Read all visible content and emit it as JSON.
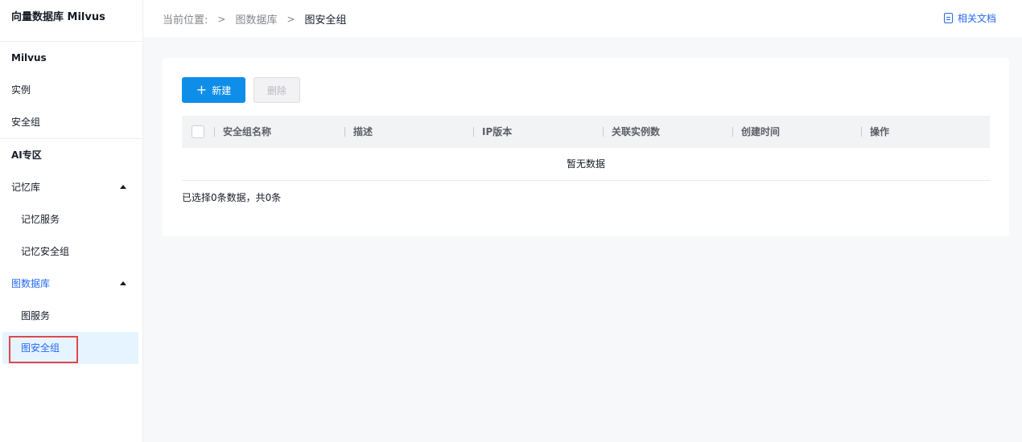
{
  "sidebar": {
    "title": "向量数据库 Milvus",
    "groups": [
      {
        "head": "Milvus",
        "items": [
          "实例",
          "安全组"
        ]
      },
      {
        "head": "AI专区"
      }
    ],
    "memory": {
      "label": "记忆库",
      "children": [
        "记忆服务",
        "记忆安全组"
      ]
    },
    "graph": {
      "label": "图数据库",
      "children": [
        "图服务",
        "图安全组"
      ]
    }
  },
  "breadcrumb": {
    "prefix": "当前位置:",
    "items": [
      "图数据库",
      "图安全组"
    ],
    "separator": ">"
  },
  "doc_link": "相关文档",
  "toolbar": {
    "new_label": "新建",
    "new_icon": "+",
    "delete_label": "删除"
  },
  "table": {
    "columns": [
      "安全组名称",
      "描述",
      "IP版本",
      "关联实例数",
      "创建时间",
      "操作"
    ],
    "empty_text": "暂无数据"
  },
  "summary": "已选择0条数据，共0条",
  "colors": {
    "primary": "#0f8ee9",
    "link": "#2468f2",
    "highlight_outline": "#e0474c"
  }
}
